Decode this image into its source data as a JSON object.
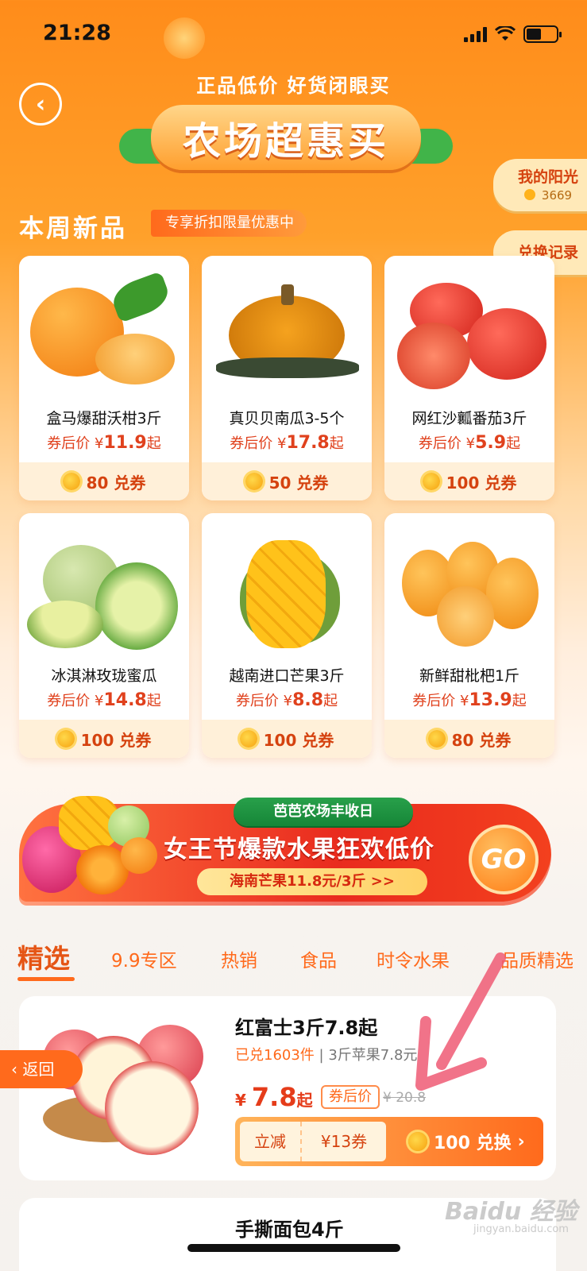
{
  "status_bar": {
    "time": "21:28"
  },
  "header": {
    "slogan": "正品低价  好货闭眼买",
    "title": "农场超惠买",
    "back_icon": "chevron-left-icon"
  },
  "side_buttons": {
    "sunshine_label": "我的阳光",
    "sunshine_value": "3669",
    "records_label": "兑换记录"
  },
  "new_products": {
    "title": "本周新品",
    "tag": "专享折扣限量优惠中",
    "items": [
      {
        "name": "盒马爆甜沃柑3斤",
        "price_prefix": "券后价 ¥",
        "price": "11.9",
        "price_suffix": "起",
        "coupon": "80 兑券"
      },
      {
        "name": "真贝贝南瓜3-5个",
        "price_prefix": "券后价 ¥",
        "price": "17.8",
        "price_suffix": "起",
        "coupon": "50 兑券"
      },
      {
        "name": "网红沙瓤番茄3斤",
        "price_prefix": "券后价 ¥",
        "price": "5.9",
        "price_suffix": "起",
        "coupon": "100 兑券"
      },
      {
        "name": "冰淇淋玫珑蜜瓜",
        "price_prefix": "券后价 ¥",
        "price": "14.8",
        "price_suffix": "起",
        "coupon": "100 兑券"
      },
      {
        "name": "越南进口芒果3斤",
        "price_prefix": "券后价 ¥",
        "price": "8.8",
        "price_suffix": "起",
        "coupon": "100 兑券"
      },
      {
        "name": "新鲜甜枇杷1斤",
        "price_prefix": "券后价 ¥",
        "price": "13.9",
        "price_suffix": "起",
        "coupon": "80 兑券"
      }
    ]
  },
  "promo": {
    "ribbon": "芭芭农场丰收日",
    "title": "女王节爆款水果狂欢低价",
    "subtitle": "海南芒果11.8元/3斤 >>",
    "go": "GO"
  },
  "tabs": [
    "精选",
    "9.9专区",
    "热销",
    "食品",
    "时令水果",
    "品质精选"
  ],
  "featured": {
    "name": "红富士3斤7.8起",
    "sold": "已兑1603件",
    "desc": "| 3斤苹果7.8元",
    "currency": "¥",
    "price": "7.8",
    "price_suffix": "起",
    "after_tag": "券后价",
    "original": "¥ 20.8",
    "reduce_label": "立减",
    "coupon_value": "¥13券",
    "redeem": "100 兑换",
    "redeem_chevron": "›"
  },
  "return_button": "返回",
  "next_item": {
    "name": "手撕面包4斤"
  },
  "watermark": {
    "brand": "Baidu 经验",
    "url": "jingyan.baidu.com"
  },
  "colors": {
    "accent": "#ff6a1c",
    "price_red": "#e0411d",
    "brand_orange": "#ff8c1a"
  }
}
